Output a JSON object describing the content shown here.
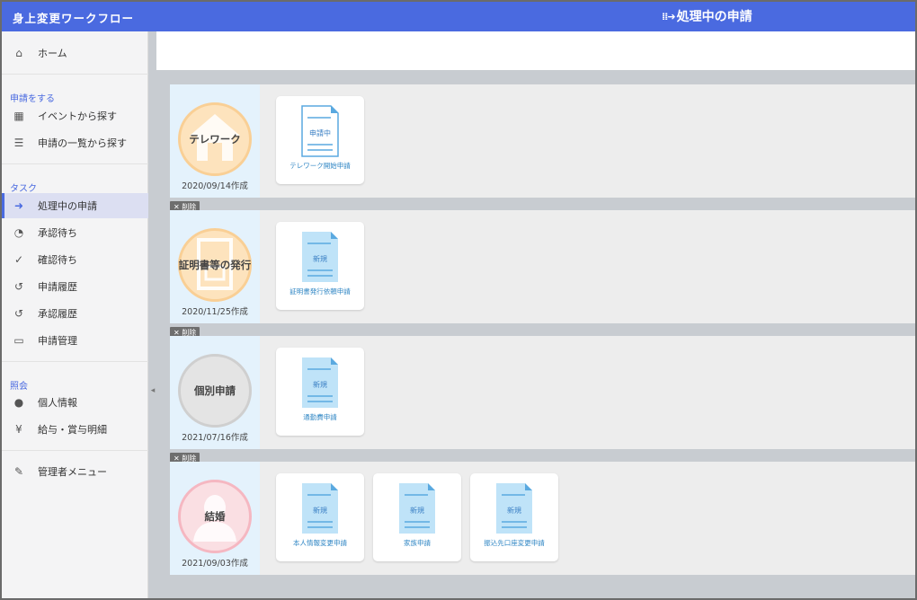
{
  "header": {
    "app_title": "身上変更ワークフロー",
    "page_title": "処理中の申請",
    "arrow_icon": "arrow-right-icon",
    "color": "#4a6ae0"
  },
  "sidebar": {
    "home": {
      "label": "ホーム",
      "icon": "home-icon"
    },
    "section_apply": "申請をする",
    "apply_items": [
      {
        "label": "イベントから探す",
        "icon": "grid-icon"
      },
      {
        "label": "申請の一覧から探す",
        "icon": "list-icon"
      }
    ],
    "section_task": "タスク",
    "task_items": [
      {
        "label": "処理中の申請",
        "icon": "arrow-right-icon",
        "active": true
      },
      {
        "label": "承認待ち",
        "icon": "stamp-icon"
      },
      {
        "label": "確認待ち",
        "icon": "check-icon"
      },
      {
        "label": "申請履歴",
        "icon": "history-icon"
      },
      {
        "label": "承認履歴",
        "icon": "history-icon"
      },
      {
        "label": "申請管理",
        "icon": "inbox-icon"
      }
    ],
    "section_inquiry": "照会",
    "inquiry_items": [
      {
        "label": "個人情報",
        "icon": "person-icon"
      },
      {
        "label": "給与・賞与明細",
        "icon": "yen-icon"
      }
    ],
    "admin": {
      "label": "管理者メニュー",
      "icon": "wrench-icon"
    }
  },
  "events": [
    {
      "name": "テレワーク",
      "date": "2020/09/14作成",
      "deletable": false,
      "theme": "orange",
      "applications": [
        {
          "doc_label": "申請中",
          "name": "テレワーク開始申請"
        }
      ]
    },
    {
      "name": "証明書等の発行",
      "date": "2020/11/25作成",
      "deletable": true,
      "delete_label": "削除",
      "theme": "orange",
      "applications": [
        {
          "doc_label": "新規",
          "name": "証明書発行依頼申請"
        }
      ]
    },
    {
      "name": "個別申請",
      "date": "2021/07/16作成",
      "deletable": true,
      "delete_label": "削除",
      "theme": "gray",
      "applications": [
        {
          "doc_label": "新規",
          "name": "通勤費申請"
        }
      ]
    },
    {
      "name": "結婚",
      "date": "2021/09/03作成",
      "deletable": true,
      "delete_label": "削除",
      "theme": "pink",
      "applications": [
        {
          "doc_label": "新規",
          "name": "本人情報変更申請"
        },
        {
          "doc_label": "新規",
          "name": "家族申請"
        },
        {
          "doc_label": "新規",
          "name": "振込先口座変更申請"
        }
      ]
    }
  ]
}
